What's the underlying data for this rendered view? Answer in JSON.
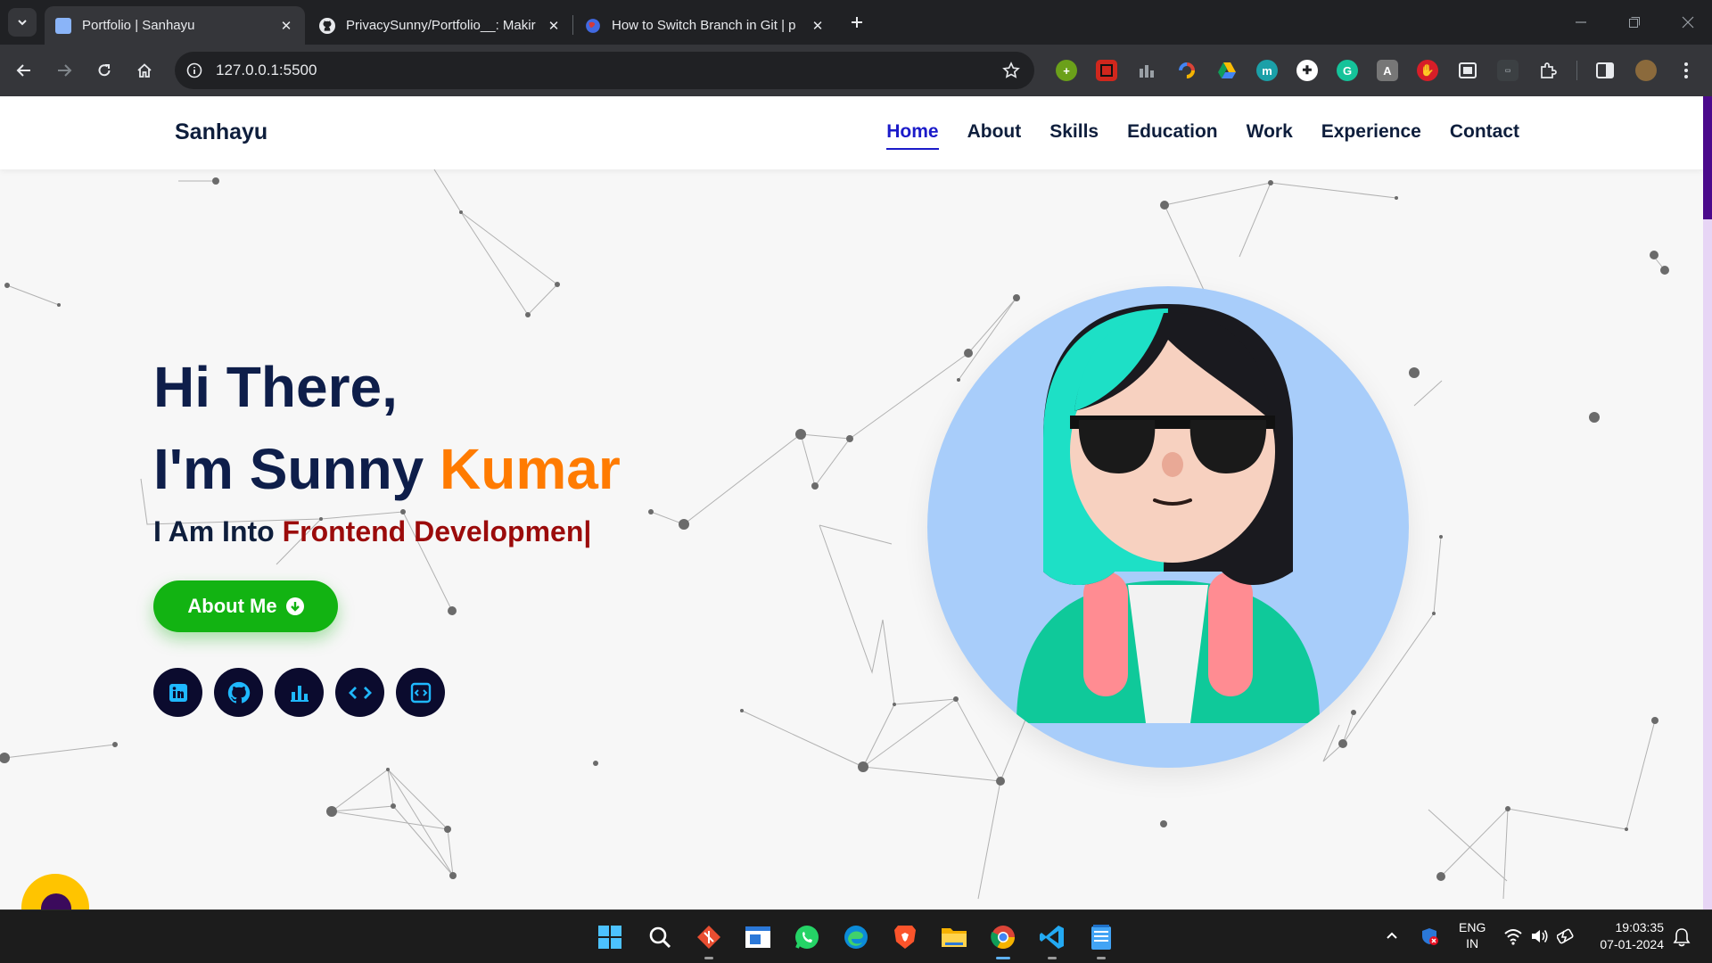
{
  "browser": {
    "tabs": [
      {
        "title": "Portfolio | Sanhayu",
        "active": true,
        "favicon": "portfolio-favicon"
      },
      {
        "title": "PrivacySunny/Portfolio__: Makir",
        "active": false,
        "favicon": "github-favicon"
      },
      {
        "title": "How to Switch Branch in Git | p",
        "active": false,
        "favicon": "globe-favicon"
      }
    ],
    "url": "127.0.0.1:5500"
  },
  "site": {
    "brand": "Sanhayu",
    "nav": [
      "Home",
      "About",
      "Skills",
      "Education",
      "Work",
      "Experience",
      "Contact"
    ],
    "active_nav": "Home",
    "hero": {
      "line1": "Hi There,",
      "line2_prefix": "I'm Sunny ",
      "line2_accent": "Kumar",
      "typed_prefix": "I Am Into ",
      "typed_role": "Frontend Developmen|",
      "button": "About Me"
    },
    "socials": [
      "linkedin-icon",
      "github-icon",
      "stats-icon",
      "code-icon",
      "code-window-icon"
    ]
  },
  "taskbar": {
    "apps": [
      "start",
      "search",
      "git-gui",
      "file-explorer-window",
      "whatsapp",
      "edge",
      "brave",
      "file-explorer",
      "chrome",
      "vscode",
      "notepad"
    ],
    "lang_top": "ENG",
    "lang_bottom": "IN",
    "time": "19:03:35",
    "date": "07-01-2024"
  },
  "colors": {
    "nav_active": "#1b1bc9",
    "hero_accent": "#ff7b00",
    "role": "#9b0b0b",
    "button": "#12b312",
    "social_bg": "#0b0b2e",
    "avatar_bg": "#a8cdfa"
  }
}
